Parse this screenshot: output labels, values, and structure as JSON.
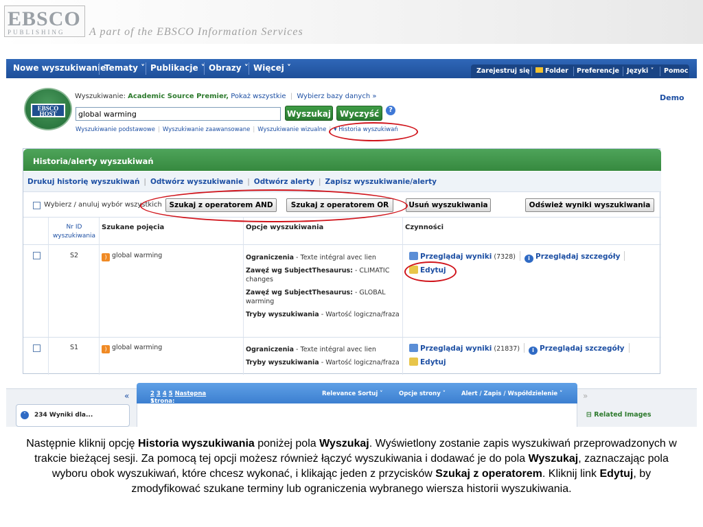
{
  "banner": {
    "logo_main": "EBSCO",
    "logo_sub": "PUBLISHING",
    "tagline": "A part of the EBSCO Information Services"
  },
  "topnav": {
    "items": [
      "Nowe wyszukiwanie",
      "Tematy ˅",
      "Publikacje ˅",
      "Obrazy ˅",
      "Więcej ˅"
    ],
    "right": [
      "Zarejestruj się",
      "Folder",
      "Preferencje",
      "Języki ˅",
      "Pomoc"
    ]
  },
  "search": {
    "logo_text": "EBSCO HOST",
    "label_prefix": "Wyszukiwanie:",
    "database": "Academic Source Premier,",
    "show_all": "Pokaż wszystkie",
    "choose_db": "Wybierz bazy danych »",
    "query": "global warming",
    "search_button": "Wyszukaj",
    "clear_button": "Wyczyść",
    "help_icon": "?",
    "demo": "Demo",
    "links": [
      "Wyszukiwanie podstawowe",
      "Wyszukiwanie zaawansowane",
      "Wyszukiwanie wizualne",
      "▾ Historia wyszukiwań"
    ]
  },
  "history": {
    "title": "Historia/alerty wyszukiwań",
    "actions": [
      "Drukuj historię wyszukiwań",
      "Odtwórz wyszukiwanie",
      "Odtwórz alerty",
      "Zapisz wyszukiwanie/alerty"
    ],
    "select_all": "Wybierz / anuluj wybór wszystkich",
    "and_button": "Szukaj z operatorem AND",
    "or_button": "Szukaj z operatorem OR",
    "delete_button": "Usuń wyszukiwania",
    "refresh_button": "Odśwież wyniki wyszukiwania",
    "columns": [
      "Nr ID wyszukiwania",
      "Szukane pojęcia",
      "Opcje wyszukiwania",
      "Czynności"
    ],
    "rows": [
      {
        "id": "S2",
        "term": "global warming",
        "opt1_label": "Ograniczenia",
        "opt1_value": " - Texte intégral avec lien",
        "opt2_label": "Zawęź wg SubjectThesaurus:",
        "opt2_value": " - CLIMATIC changes",
        "opt3_label": "Zawęź wg SubjectThesaurus:",
        "opt3_value": " - GLOBAL warming",
        "opt4_label": "Tryby wyszukiwania",
        "opt4_value": " - Wartość logiczna/fraza",
        "view_results": "Przeglądaj wyniki",
        "count": "(7328)",
        "view_details": "Przeglądaj szczegóły",
        "edit": "Edytuj"
      },
      {
        "id": "S1",
        "term": "global warming",
        "opt1_label": "Ograniczenia",
        "opt1_value": " - Texte intégral avec lien",
        "opt4_label": "Tryby wyszukiwania",
        "opt4_value": " - Wartość logiczna/fraza",
        "view_results": "Przeglądaj wyniki",
        "count": "(21837)",
        "view_details": "Przeglądaj szczegóły",
        "edit": "Edytuj"
      }
    ]
  },
  "results_bar": {
    "collapse_left": "«",
    "collapse_right": "»",
    "page_label": "Strona:",
    "pages": [
      "1",
      "2",
      "3",
      "4",
      "5"
    ],
    "next": "Następna",
    "sort": "Relevance Sortuj ˅",
    "page_options": "Opcje strony ˅",
    "alert": "Alert / Zapis / Współdzielenie ˅",
    "results_count": "234 Wyniki dla...",
    "related_images": "⊟ Related Images"
  },
  "caption": {
    "p1": "Następnie kliknij opcję ",
    "b1": "Historia wyszukiwania",
    "p2": " poniżej pola ",
    "b2": "Wyszukaj",
    "p3": ". Wyświetlony zostanie zapis wyszukiwań przeprowadzonych w trakcie bieżącej sesji. Za pomocą tej opcji możesz również łączyć wyszukiwania i dodawać je do pola ",
    "b3": "Wyszukaj",
    "p4": ", zaznaczając pola wyboru obok wyszukiwań, które chcesz wykonać, i klikając jeden z przycisków ",
    "b4": "Szukaj z operatorem",
    "p5": ". Kliknij link ",
    "b5": "Edytuj",
    "p6": ", by zmodyfikować szukane terminy lub ograniczenia wybranego wiersza historii wyszukiwania."
  },
  "colors": {
    "nav_blue": "#1e4f99",
    "green_header": "#36893f",
    "link_blue": "#1d4fa3",
    "annotation_red": "#d0141b"
  }
}
